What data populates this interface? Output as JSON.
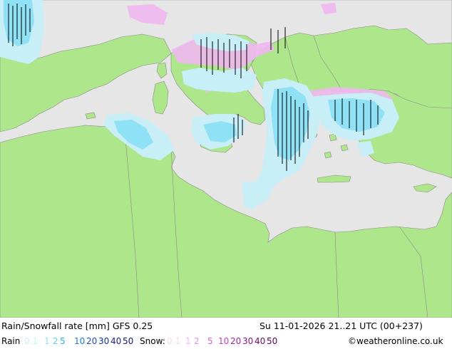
{
  "title": "Rain/Snowfall rate [mm] GFS 0.25",
  "valid_time": "Su 11-01-2026 21..21 UTC (00+237)",
  "credit": "©weatheronline.co.uk",
  "rain_legend": {
    "label": "Rain",
    "items": [
      {
        "text": "0.1",
        "color": "#c8eef8"
      },
      {
        "text": "1",
        "color": "#8fe1f5"
      },
      {
        "text": "2",
        "color": "#5ccdf0"
      },
      {
        "text": "5",
        "color": "#2aaee8"
      },
      {
        "text": "10",
        "color": "#1a7fd8"
      },
      {
        "text": "20",
        "color": "#1b4fc0"
      },
      {
        "text": "30",
        "color": "#14309a"
      },
      {
        "text": "40",
        "color": "#222090"
      },
      {
        "text": "50",
        "color": "#12127a"
      }
    ]
  },
  "snow_legend": {
    "label": "Snow:",
    "items": [
      {
        "text": "0.1",
        "color": "#f4d8f4"
      },
      {
        "text": "1",
        "color": "#f0b8f0"
      },
      {
        "text": "2",
        "color": "#e890e8"
      },
      {
        "text": "5",
        "color": "#d860d8"
      },
      {
        "text": "10",
        "color": "#c040c0"
      },
      {
        "text": "20",
        "color": "#a020a0"
      },
      {
        "text": "30",
        "color": "#8a108a"
      },
      {
        "text": "40",
        "color": "#700870"
      },
      {
        "text": "50",
        "color": "#580058"
      }
    ]
  },
  "colors": {
    "land": "#aee68c",
    "sea": "#e6e6e6",
    "border": "#8a8a8a",
    "rain_light": "#c8eef8",
    "rain_mid": "#8fe1f5",
    "snow": "#f0b8f0"
  }
}
